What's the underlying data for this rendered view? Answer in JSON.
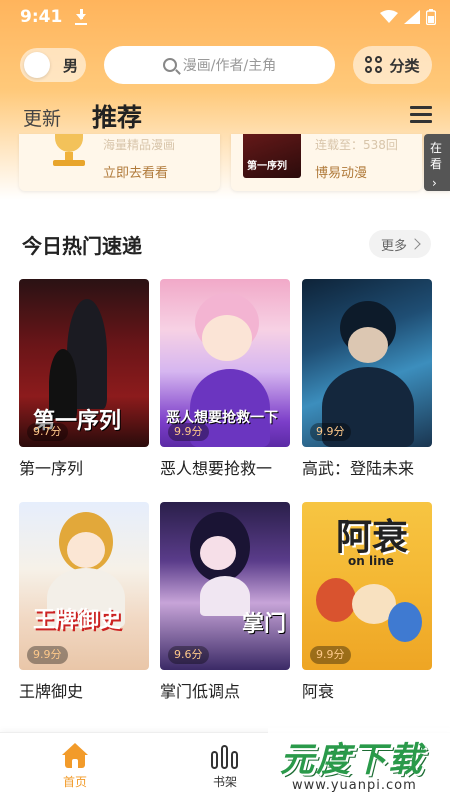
{
  "status_bar": {
    "time": "9:41",
    "icons": [
      "download-icon",
      "wifi-icon",
      "signal-icon",
      "battery-icon"
    ]
  },
  "header": {
    "gender_toggle_label": "男",
    "search_placeholder": "漫画/作者/主角",
    "category_label": "分类"
  },
  "tabs": [
    {
      "label": "更新",
      "active": false
    },
    {
      "label": "推荐",
      "active": true
    }
  ],
  "banners": [
    {
      "faded_text": "海量精品漫画",
      "link_text": "立即去看看"
    },
    {
      "cover_text": "第一序列",
      "faded_text": "连载至：538回",
      "link_text": "博易动漫"
    },
    {
      "side_text": "在看"
    }
  ],
  "section": {
    "title": "今日热门速递",
    "more_label": "更多"
  },
  "comics": [
    {
      "title": "第一序列",
      "score": "9.7分",
      "cover_text": "第一序列"
    },
    {
      "title": "恶人想要抢救一",
      "score": "9.9分",
      "cover_text": "恶人想要抢救一下"
    },
    {
      "title": "高武：登陆未来",
      "score": "9.9分",
      "cover_text": ""
    },
    {
      "title": "王牌御史",
      "score": "9.9分",
      "cover_text": "王牌御史"
    },
    {
      "title": "掌门低调点",
      "score": "9.6分",
      "cover_text": "掌门"
    },
    {
      "title": "阿衰",
      "score": "9.9分",
      "cover_text": "阿衰",
      "cover_subtext": "on line"
    }
  ],
  "bottom_nav": [
    {
      "label": "首页",
      "active": true,
      "icon": "home-icon"
    },
    {
      "label": "书架",
      "active": false,
      "icon": "bookshelf-icon"
    }
  ],
  "watermark": {
    "main": "元度下载",
    "sub": "www.yuanpi.com"
  },
  "colors": {
    "accent": "#f29b2a",
    "header_gradient_top": "#ffb45c",
    "score_text": "#ffc98a"
  }
}
